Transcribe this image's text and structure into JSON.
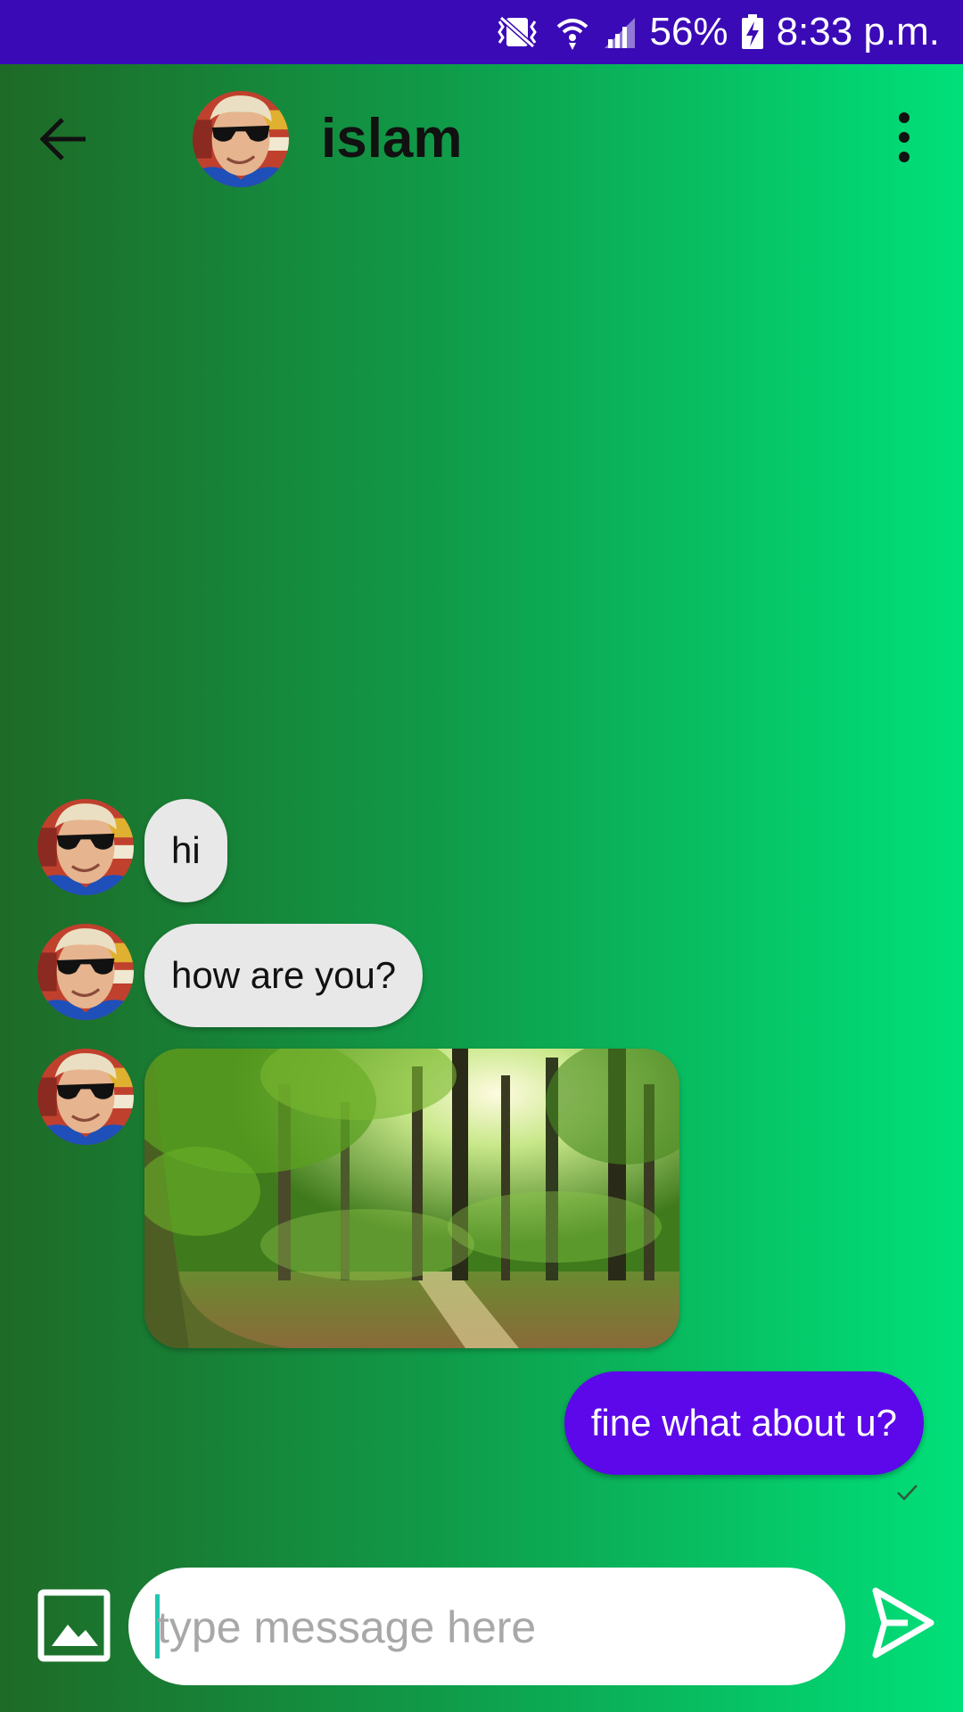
{
  "status_bar": {
    "battery": "56%",
    "time": "8:33 p.m.",
    "icons": [
      "vibrate-icon",
      "wifi-icon",
      "signal-icon",
      "battery-charging-icon"
    ]
  },
  "toolbar": {
    "title": "islam",
    "back_icon": "arrow-back-icon",
    "menu_icon": "more-vert-icon"
  },
  "messages": [
    {
      "direction": "incoming",
      "type": "text",
      "text": "hi"
    },
    {
      "direction": "incoming",
      "type": "text",
      "text": "how are you?"
    },
    {
      "direction": "incoming",
      "type": "image",
      "image": "forest-photo"
    },
    {
      "direction": "outgoing",
      "type": "text",
      "text": "fine what about u?",
      "status": "sent-check-icon"
    }
  ],
  "composer": {
    "placeholder": "type message here",
    "value": "",
    "gallery_icon": "image-icon",
    "send_icon": "send-icon"
  },
  "colors": {
    "status_bar": "#3a0ab6",
    "outgoing_bubble": "#5c08ea",
    "incoming_bubble": "#e8e8e8",
    "gradient_start": "#1e6a26",
    "gradient_end": "#00e07a"
  }
}
